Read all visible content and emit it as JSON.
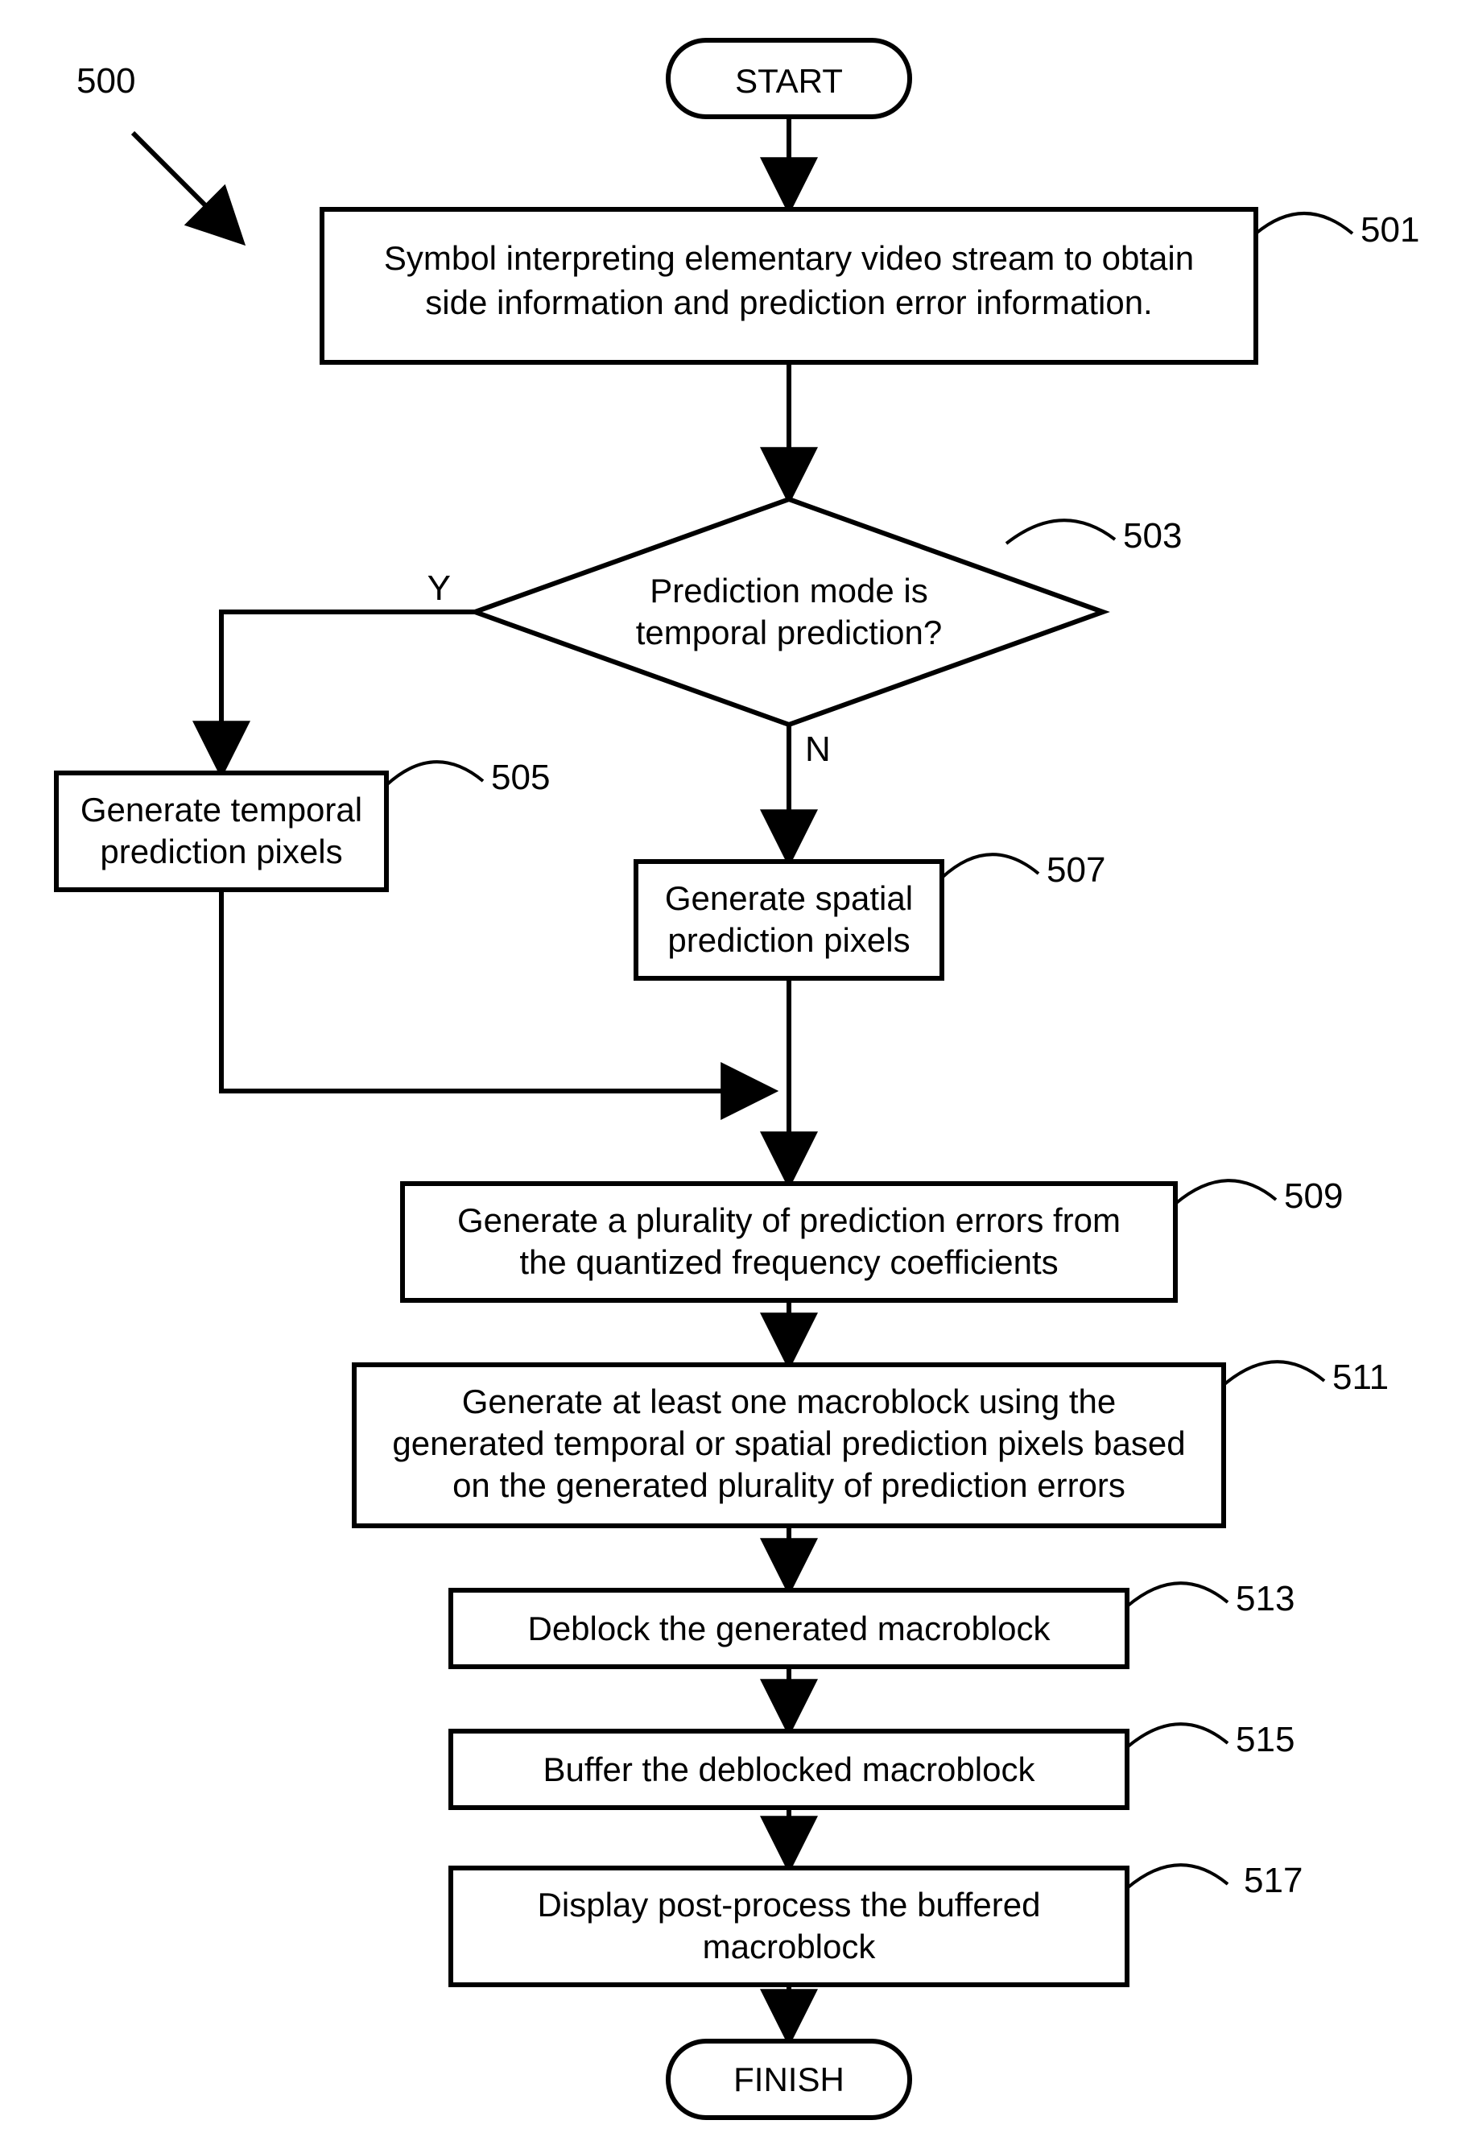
{
  "figure_label": "500",
  "terminators": {
    "start": "START",
    "finish": "FINISH"
  },
  "nodes": {
    "n501": {
      "ref": "501",
      "lines": [
        "Symbol interpreting elementary video stream to obtain",
        "side information and prediction error information."
      ]
    },
    "n503": {
      "ref": "503",
      "lines": [
        "Prediction mode is",
        "temporal prediction?"
      ]
    },
    "n505": {
      "ref": "505",
      "lines": [
        "Generate temporal",
        "prediction pixels"
      ]
    },
    "n507": {
      "ref": "507",
      "lines": [
        "Generate spatial",
        "prediction pixels"
      ]
    },
    "n509": {
      "ref": "509",
      "lines": [
        "Generate a plurality of prediction errors from",
        "the quantized frequency coefficients"
      ]
    },
    "n511": {
      "ref": "511",
      "lines": [
        "Generate at least one macroblock using the",
        "generated temporal or spatial prediction pixels based",
        "on the generated plurality of prediction errors"
      ]
    },
    "n513": {
      "ref": "513",
      "lines": [
        "Deblock the generated macroblock"
      ]
    },
    "n515": {
      "ref": "515",
      "lines": [
        "Buffer the deblocked macroblock"
      ]
    },
    "n517": {
      "ref": "517",
      "lines": [
        "Display post-process the buffered",
        "macroblock"
      ]
    }
  },
  "branch_labels": {
    "yes": "Y",
    "no": "N"
  },
  "chart_data": {
    "type": "flowchart",
    "title": "",
    "nodes": [
      {
        "id": "start",
        "type": "terminator",
        "label": "START"
      },
      {
        "id": "501",
        "type": "process",
        "label": "Symbol interpreting elementary video stream to obtain side information and prediction error information."
      },
      {
        "id": "503",
        "type": "decision",
        "label": "Prediction mode is temporal prediction?"
      },
      {
        "id": "505",
        "type": "process",
        "label": "Generate temporal prediction pixels"
      },
      {
        "id": "507",
        "type": "process",
        "label": "Generate spatial prediction pixels"
      },
      {
        "id": "509",
        "type": "process",
        "label": "Generate a plurality of prediction errors from the quantized frequency coefficients"
      },
      {
        "id": "511",
        "type": "process",
        "label": "Generate at least one macroblock using the generated temporal or spatial prediction pixels based on the generated plurality of prediction errors"
      },
      {
        "id": "513",
        "type": "process",
        "label": "Deblock the generated macroblock"
      },
      {
        "id": "515",
        "type": "process",
        "label": "Buffer the deblocked macroblock"
      },
      {
        "id": "517",
        "type": "process",
        "label": "Display post-process the buffered macroblock"
      },
      {
        "id": "finish",
        "type": "terminator",
        "label": "FINISH"
      }
    ],
    "edges": [
      {
        "from": "start",
        "to": "501"
      },
      {
        "from": "501",
        "to": "503"
      },
      {
        "from": "503",
        "to": "505",
        "label": "Y"
      },
      {
        "from": "503",
        "to": "507",
        "label": "N"
      },
      {
        "from": "505",
        "to": "509"
      },
      {
        "from": "507",
        "to": "509"
      },
      {
        "from": "509",
        "to": "511"
      },
      {
        "from": "511",
        "to": "513"
      },
      {
        "from": "513",
        "to": "515"
      },
      {
        "from": "515",
        "to": "517"
      },
      {
        "from": "517",
        "to": "finish"
      }
    ]
  }
}
